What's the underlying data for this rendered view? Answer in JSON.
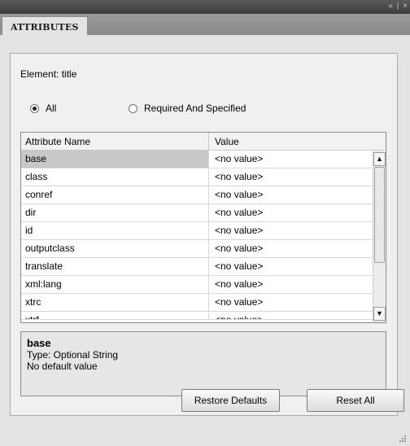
{
  "window": {
    "controls": "« | ×"
  },
  "tab": {
    "label": "ATTRIBUTES"
  },
  "element": {
    "label": "Element: title"
  },
  "filter": {
    "option_all": "All",
    "option_required": "Required And Specified",
    "selected": "All"
  },
  "table": {
    "headers": {
      "name": "Attribute Name",
      "value": "Value"
    },
    "rows": [
      {
        "name": "base",
        "value": "<no value>"
      },
      {
        "name": "class",
        "value": "<no value>"
      },
      {
        "name": "conref",
        "value": "<no value>"
      },
      {
        "name": "dir",
        "value": "<no value>"
      },
      {
        "name": "id",
        "value": "<no value>"
      },
      {
        "name": "outputclass",
        "value": "<no value>"
      },
      {
        "name": "translate",
        "value": "<no value>"
      },
      {
        "name": "xml:lang",
        "value": "<no value>"
      },
      {
        "name": "xtrc",
        "value": "<no value>"
      },
      {
        "name": "xtrf",
        "value": "<no value>"
      }
    ],
    "selected_row": "base"
  },
  "info": {
    "name": "base",
    "type": "Type: Optional String",
    "default": "No default value"
  },
  "buttons": {
    "restore": "Restore Defaults",
    "reset": "Reset All"
  }
}
